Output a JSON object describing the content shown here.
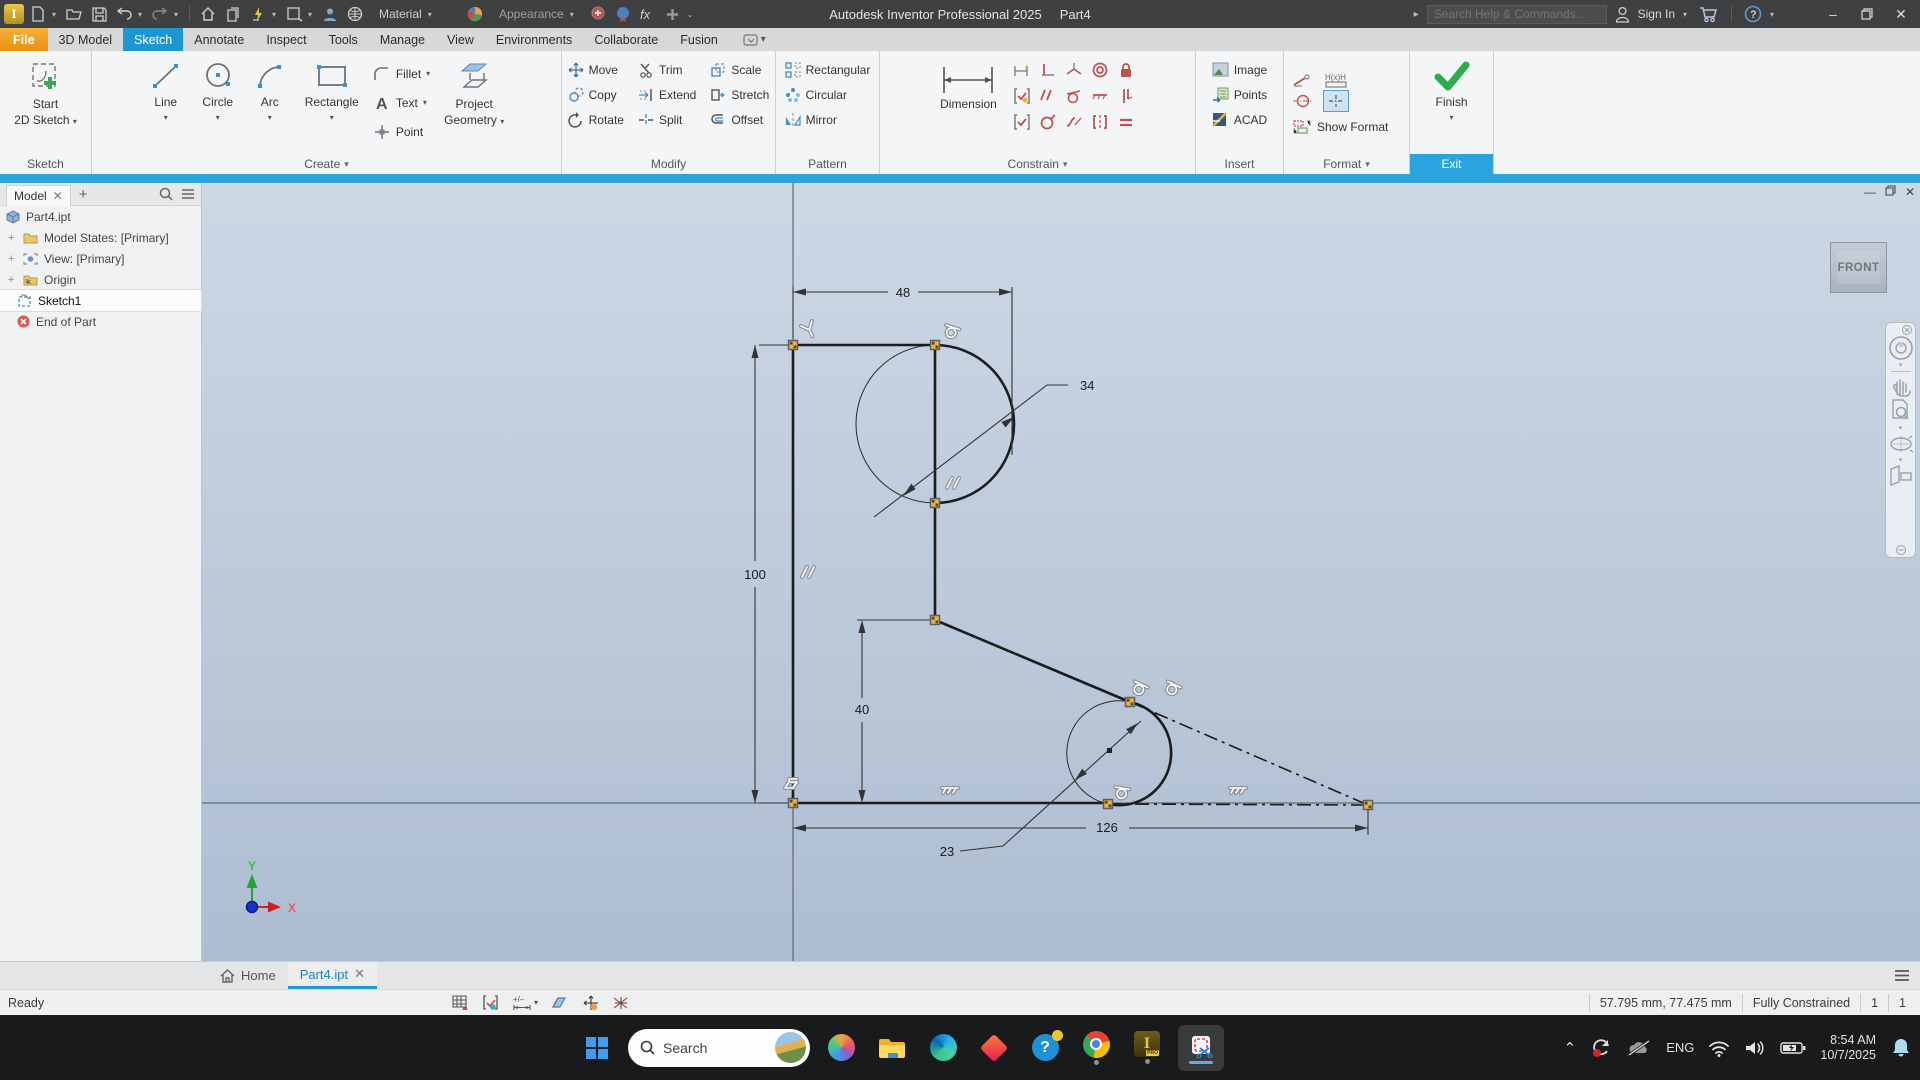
{
  "titlebar": {
    "app_title": "Autodesk Inventor Professional 2025",
    "doc_title": "Part4",
    "material": "Material",
    "appearance": "Appearance",
    "search_placeholder": "Search Help & Commands...",
    "sign_in": "Sign In"
  },
  "ribbon": {
    "tabs": [
      "File",
      "3D Model",
      "Sketch",
      "Annotate",
      "Inspect",
      "Tools",
      "Manage",
      "View",
      "Environments",
      "Collaborate",
      "Fusion"
    ],
    "panels": {
      "sketch": {
        "label": "Sketch",
        "start1": "Start",
        "start2": "2D Sketch"
      },
      "create": {
        "label": "Create",
        "line": "Line",
        "circle": "Circle",
        "arc": "Arc",
        "rectangle": "Rectangle",
        "fillet": "Fillet",
        "text": "Text",
        "point": "Point",
        "project1": "Project",
        "project2": "Geometry"
      },
      "modify": {
        "label": "Modify",
        "move": "Move",
        "copy": "Copy",
        "rotate": "Rotate",
        "trim": "Trim",
        "extend": "Extend",
        "split": "Split",
        "scale": "Scale",
        "stretch": "Stretch",
        "offset": "Offset"
      },
      "pattern": {
        "label": "Pattern",
        "rectangular": "Rectangular",
        "circular": "Circular",
        "mirror": "Mirror"
      },
      "constrain": {
        "label": "Constrain",
        "dimension": "Dimension"
      },
      "insert": {
        "label": "Insert",
        "image": "Image",
        "points": "Points",
        "acad": "ACAD"
      },
      "format": {
        "label": "Format",
        "show_format": "Show Format"
      },
      "exit": {
        "label": "Exit",
        "finish": "Finish"
      }
    }
  },
  "browser": {
    "tab": "Model",
    "root": "Part4.ipt",
    "model_states": "Model States: [Primary]",
    "view": "View: [Primary]",
    "origin": "Origin",
    "sketch1": "Sketch1",
    "end_of_part": "End of Part"
  },
  "canvas": {
    "viewcube": "FRONT",
    "dims": {
      "width": "48",
      "dia_top": "34",
      "height": "100",
      "mid": "40",
      "length": "126",
      "dia_bottom": "23"
    },
    "triad": {
      "x": "X",
      "y": "Y"
    }
  },
  "doc_tabs": {
    "home": "Home",
    "part": "Part4.ipt"
  },
  "statusbar": {
    "ready": "Ready",
    "coords": "57.795 mm, 77.475 mm",
    "constraint_state": "Fully Constrained",
    "count1": "1",
    "count2": "1"
  },
  "taskbar": {
    "search": "Search",
    "lang": "ENG",
    "time": "8:54 AM",
    "date": "10/7/2025"
  }
}
